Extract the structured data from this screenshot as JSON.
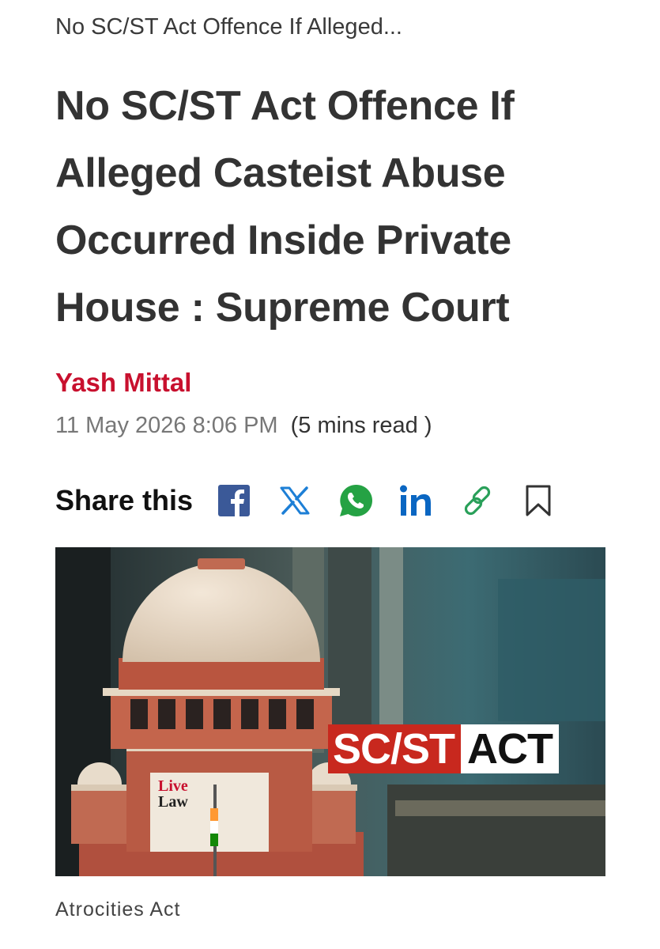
{
  "breadcrumb": "No SC/ST Act Offence If Alleged...",
  "article": {
    "headline": "No SC/ST Act Offence If Alleged Casteist Abuse Occurred Inside Private House : Supreme Court",
    "author": "Yash Mittal",
    "date": "11 May 2026 8:06 PM",
    "read_time": "(5 mins read )"
  },
  "share": {
    "label": "Share this",
    "icons": [
      "facebook-icon",
      "x-icon",
      "whatsapp-icon",
      "linkedin-icon",
      "link-icon",
      "bookmark-icon"
    ]
  },
  "hero": {
    "badge_part1": "SC/ST",
    "badge_part2": "ACT",
    "logo_line1": "Live",
    "logo_line2": "Law"
  },
  "tag": "Atrocities Act",
  "colors": {
    "author": "#c8102e",
    "facebook": "#3b5998",
    "x": "#1d7fd6",
    "whatsapp": "#25a244",
    "linkedin": "#0a66c2",
    "link": "#2aa05a",
    "bookmark": "#333333"
  }
}
